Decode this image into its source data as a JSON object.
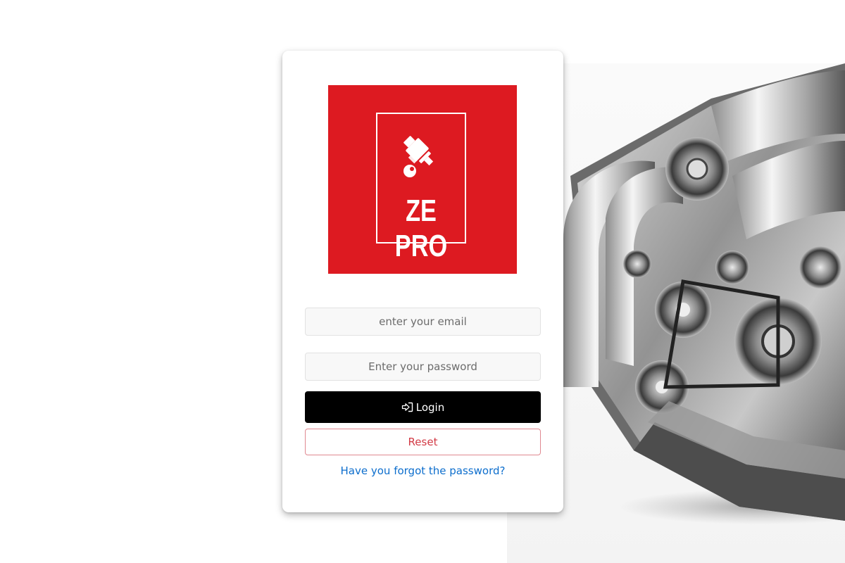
{
  "brand": {
    "logo_text": "ZE PRO",
    "logo_color": "#dd1a21"
  },
  "form": {
    "email_placeholder": "enter your email",
    "email_value": "",
    "password_placeholder": "Enter your password",
    "password_value": "",
    "login_label": "Login",
    "login_icon": "sign-in-icon",
    "reset_label": "Reset",
    "forgot_link": "Have you forgot the password?"
  },
  "colors": {
    "login_button": "#000000",
    "reset_text": "#d23a45",
    "link": "#0d6ecd"
  },
  "background": {
    "image": "engine-photo"
  }
}
